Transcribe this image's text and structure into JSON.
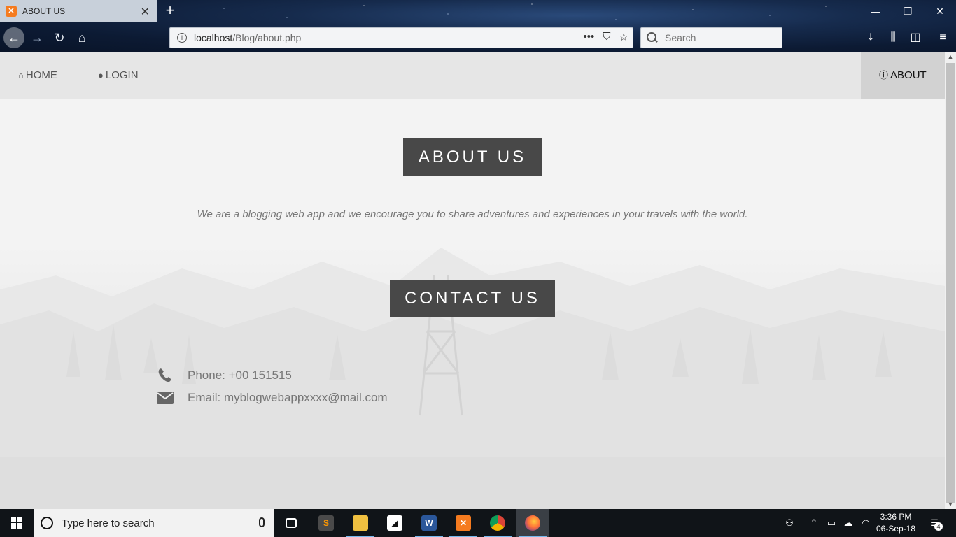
{
  "browser": {
    "tab_title": "ABOUT US",
    "favicon_letter": "✕",
    "url_host": "localhost",
    "url_path": "/Blog/about.php",
    "search_placeholder": "Search",
    "icons": [
      "back-icon",
      "forward-icon",
      "reload-icon",
      "home-icon",
      "page-actions-icon",
      "pocket-icon",
      "bookmark-star-icon",
      "download-icon",
      "library-icon",
      "sidebar-icon",
      "menu-icon"
    ]
  },
  "site_nav": {
    "home_label": "HOME",
    "login_label": "LOGIN",
    "about_label": "ABOUT"
  },
  "main": {
    "about_heading": "ABOUT US",
    "about_text": "We are a blogging web app and we encourage you to share adventures and experiences in your travels with the world.",
    "contact_heading": "CONTACT US",
    "phone": "Phone: +00 151515",
    "email": "Email: myblogwebappxxxx@mail.com"
  },
  "taskbar": {
    "search_placeholder": "Type here to search",
    "time": "3:36 PM",
    "date": "06-Sep-18",
    "notification_count": "4",
    "apps": [
      "task-view",
      "sublime-text",
      "file-explorer",
      "sticky-notes",
      "word",
      "xampp",
      "chrome",
      "firefox"
    ]
  },
  "colors": {
    "heading_bg": "#484848",
    "page_bg": "#f3f3f3",
    "nav_bg": "#e6e6e6",
    "nav_active_bg": "#d2d2d2"
  }
}
